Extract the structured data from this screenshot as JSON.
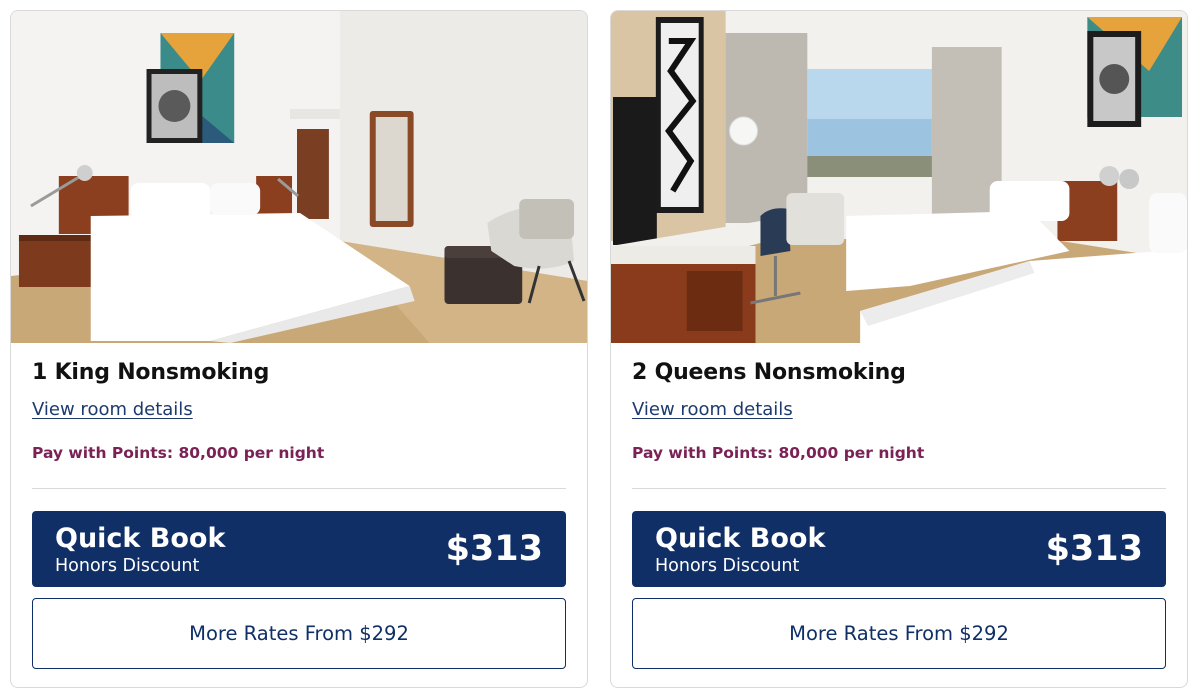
{
  "rooms": [
    {
      "image": "hotel-room-king-bed-photo",
      "title": "1 King Nonsmoking",
      "details_link": "View room details",
      "points_text": "Pay with Points: 80,000 per night",
      "quick_book": {
        "label": "Quick Book",
        "rate_name": "Honors Discount",
        "price": "$313"
      },
      "more_rates": "More Rates From $292"
    },
    {
      "image": "hotel-room-two-queen-beds-photo",
      "title": "2 Queens Nonsmoking",
      "details_link": "View room details",
      "points_text": "Pay with Points: 80,000 per night",
      "quick_book": {
        "label": "Quick Book",
        "rate_name": "Honors Discount",
        "price": "$313"
      },
      "more_rates": "More Rates From $292"
    }
  ],
  "colors": {
    "primary_navy": "#0f2f66",
    "link": "#1c3a6e",
    "points_text": "#7a2255",
    "border": "#d9d9d9"
  }
}
